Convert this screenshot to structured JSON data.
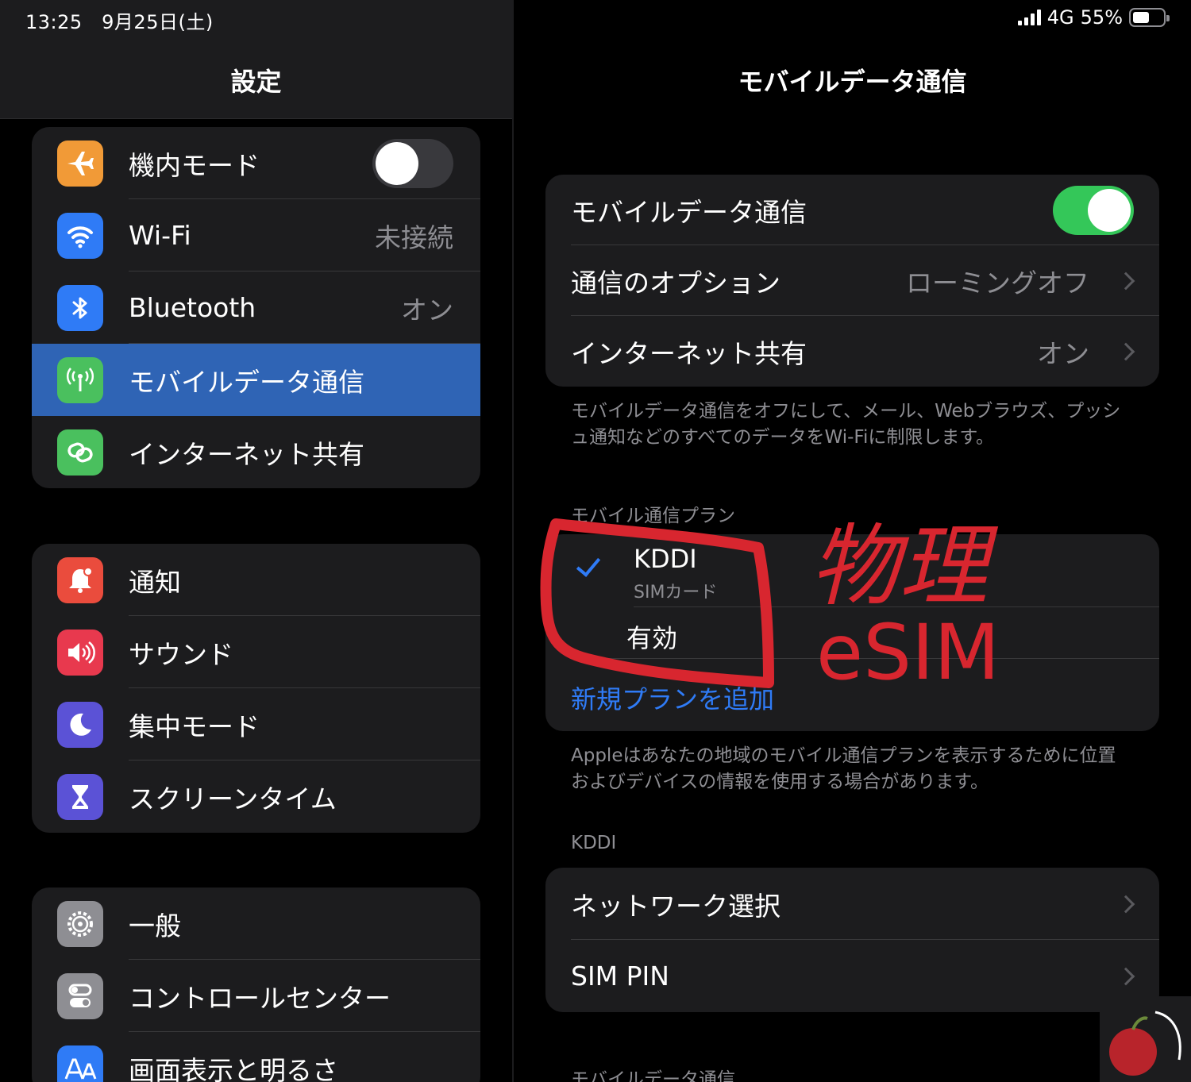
{
  "status": {
    "time_date": "13:25　9月25日(土)",
    "network": "4G",
    "battery": "55%",
    "battery_level": 0.55
  },
  "sidebar": {
    "title": "設定",
    "groups": [
      {
        "items": [
          {
            "label": "機内モード",
            "icon": "airplane-icon",
            "color": "#f19a37",
            "toggle": false
          },
          {
            "label": "Wi-Fi",
            "value": "未接続",
            "icon": "wifi-icon",
            "color": "#2f7bf6"
          },
          {
            "label": "Bluetooth",
            "value": "オン",
            "icon": "bluetooth-icon",
            "color": "#2f7bf6"
          },
          {
            "label": "モバイルデータ通信",
            "icon": "antenna-icon",
            "color": "#4ac05e",
            "selected": true
          },
          {
            "label": "インターネット共有",
            "icon": "link-icon",
            "color": "#4ac05e"
          }
        ]
      },
      {
        "items": [
          {
            "label": "通知",
            "icon": "bell-icon",
            "color": "#ea4c3d"
          },
          {
            "label": "サウンド",
            "icon": "speaker-icon",
            "color": "#e8394e"
          },
          {
            "label": "集中モード",
            "icon": "moon-icon",
            "color": "#5b52d6"
          },
          {
            "label": "スクリーンタイム",
            "icon": "hourglass-icon",
            "color": "#5b52d6"
          }
        ]
      },
      {
        "items": [
          {
            "label": "一般",
            "icon": "gear-icon",
            "color": "#8e8e93"
          },
          {
            "label": "コントロールセンター",
            "icon": "switches-icon",
            "color": "#8e8e93"
          },
          {
            "label": "画面表示と明るさ",
            "icon": "text-size-icon",
            "color": "#2f7bf6"
          }
        ]
      }
    ]
  },
  "detail": {
    "title": "モバイルデータ通信",
    "main_rows": {
      "mobile_data": {
        "label": "モバイルデータ通信",
        "toggle": true
      },
      "options": {
        "label": "通信のオプション",
        "value": "ローミングオフ"
      },
      "hotspot": {
        "label": "インターネット共有",
        "value": "オン"
      }
    },
    "footnote1": "モバイルデータ通信をオフにして、メール、Webブラウズ、プッシュ通知などのすべてのデータをWi-Fiに制限します。",
    "plans_header": "モバイル通信プラン",
    "plan": {
      "name": "KDDI",
      "sub": "SIMカード",
      "status": "有効",
      "add": "新規プランを追加"
    },
    "footnote2": "Appleはあなたの地域のモバイル通信プランを表示するために位置およびデバイスの情報を使用する場合があります。",
    "carrier_header": "KDDI",
    "carrier_rows": {
      "network": "ネットワーク選択",
      "sim_pin": "SIM PIN"
    },
    "bottom_header": "モバイルデータ通信"
  },
  "annotation": {
    "line1": "物理",
    "line2": "eSIM",
    "color": "#d8262f"
  }
}
